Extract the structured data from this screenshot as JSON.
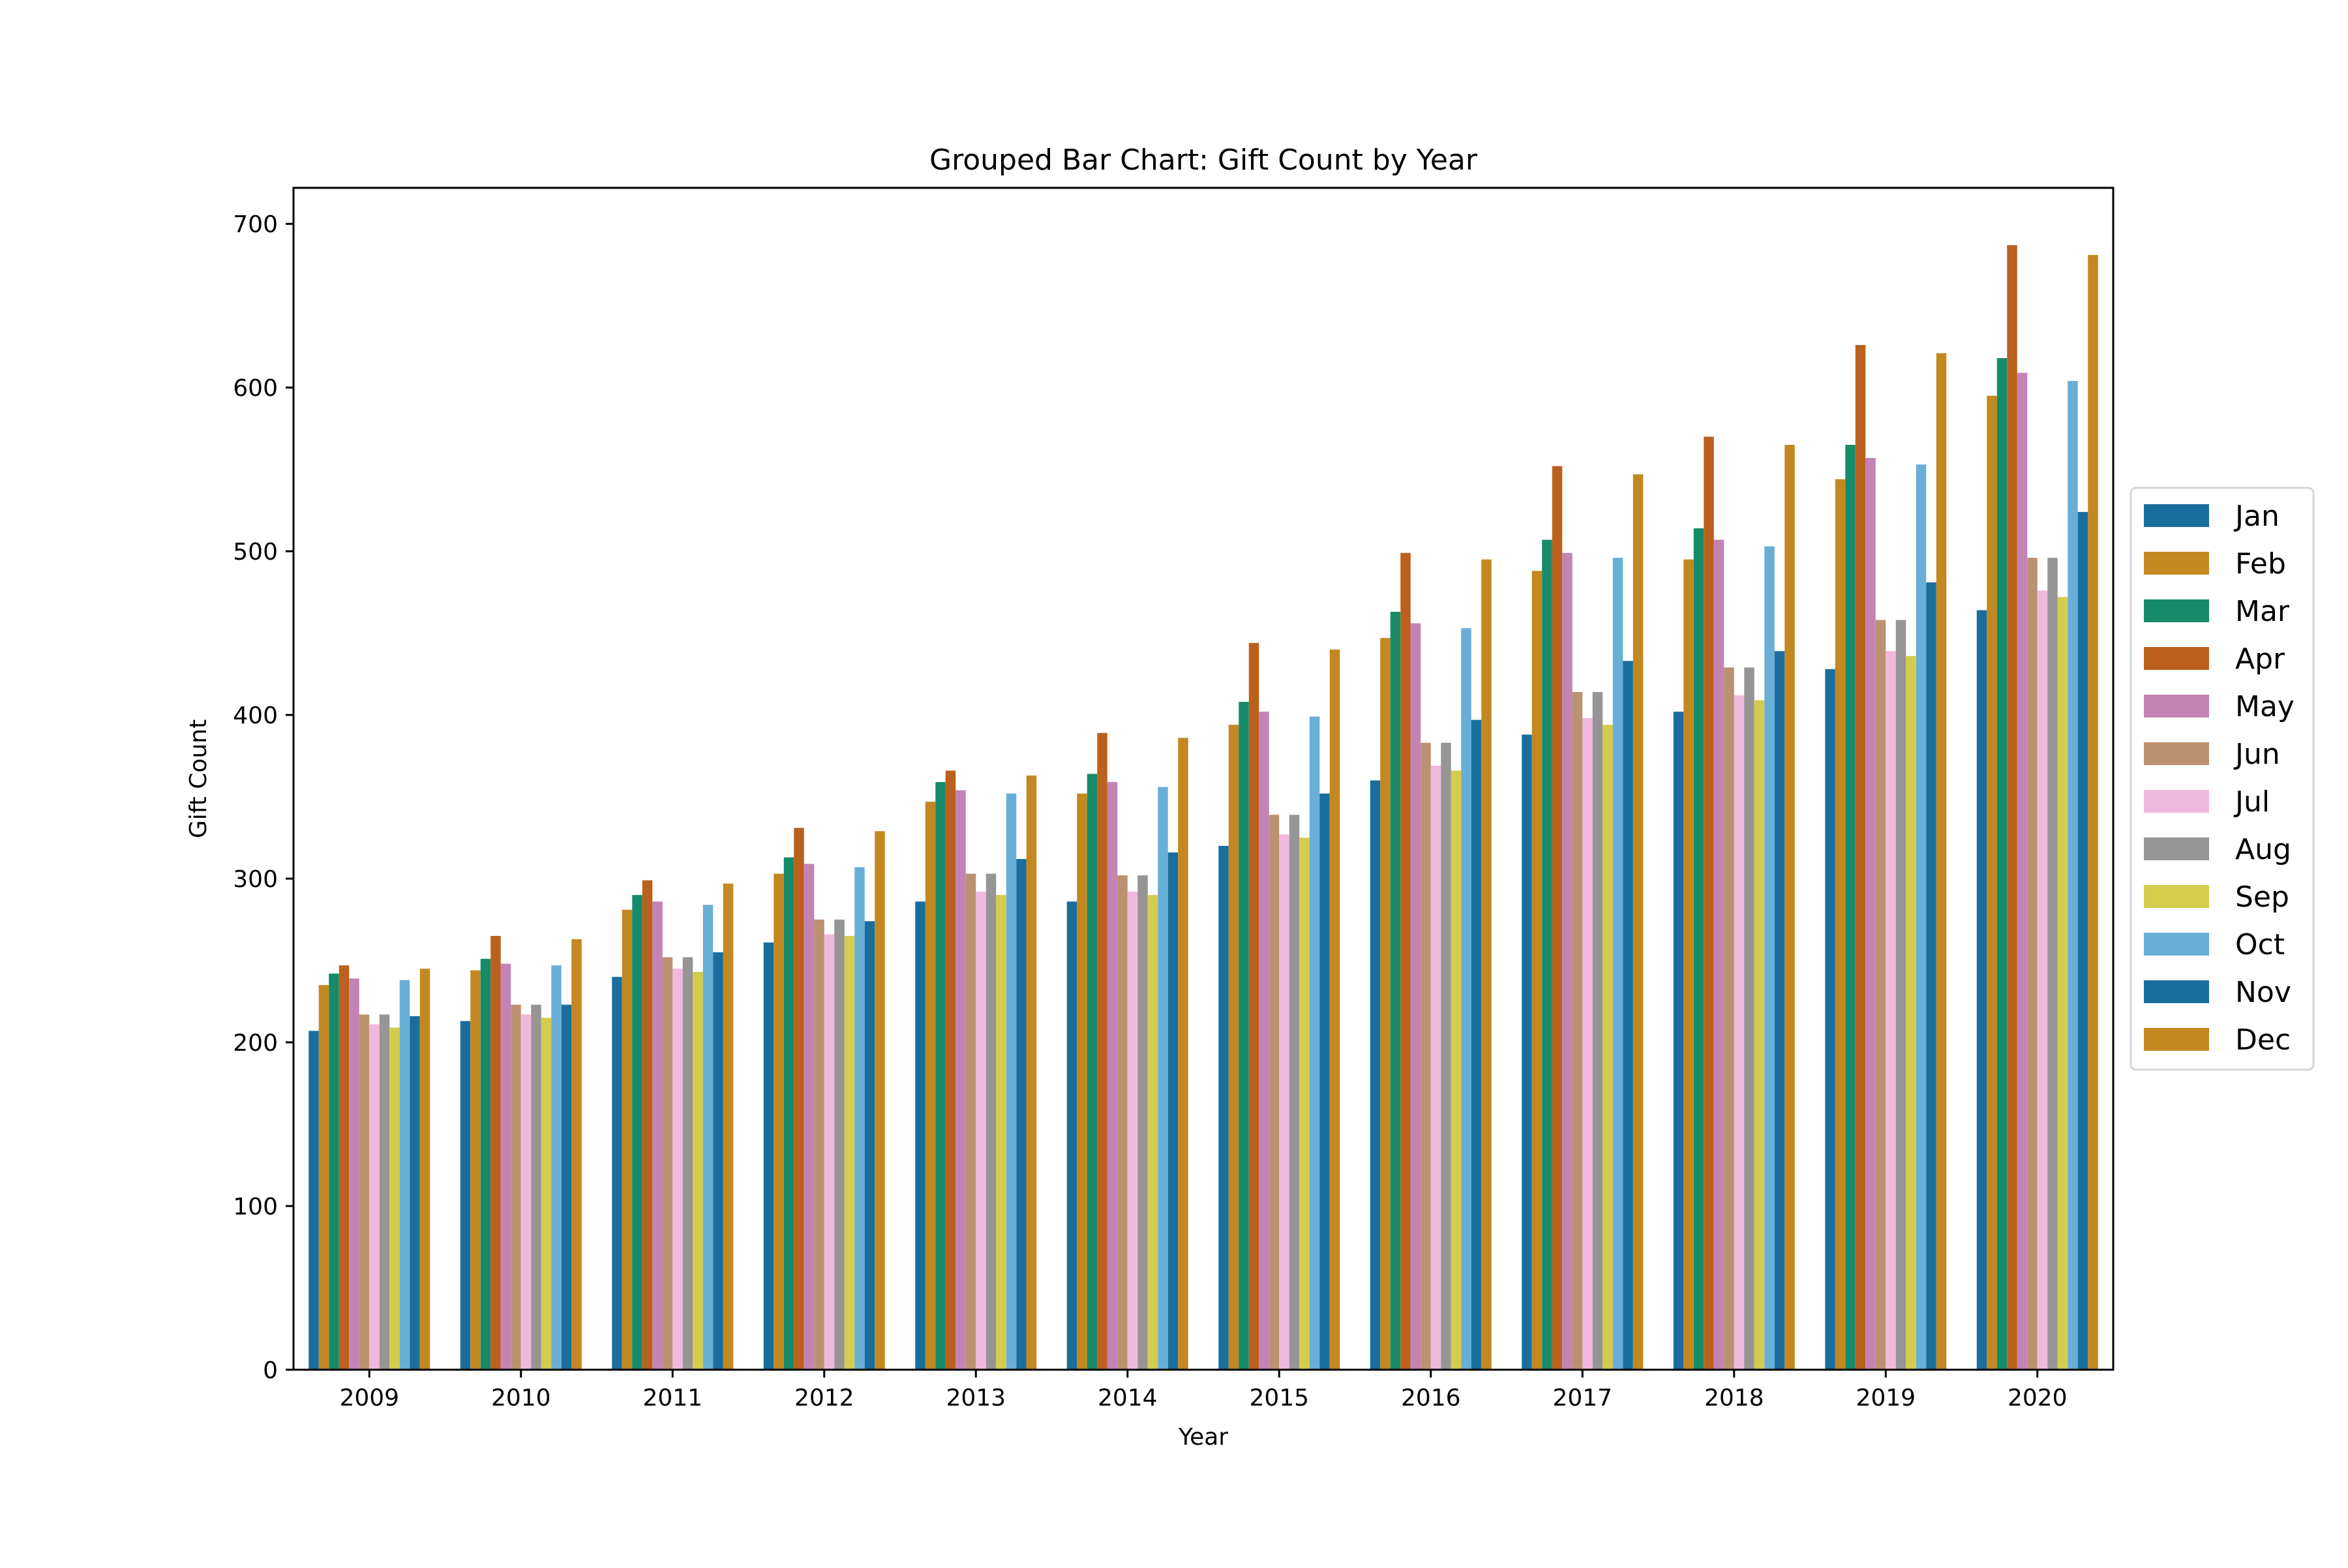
{
  "chart_data": {
    "type": "bar",
    "title": "Grouped Bar Chart: Gift Count by Year",
    "xlabel": "Year",
    "ylabel": "Gift Count",
    "ylim": [
      0,
      722
    ],
    "yticks": [
      0,
      100,
      200,
      300,
      400,
      500,
      600,
      700
    ],
    "grid": false,
    "legend_position": "center-right-outside",
    "categories": [
      "2009",
      "2010",
      "2011",
      "2012",
      "2013",
      "2014",
      "2015",
      "2016",
      "2017",
      "2018",
      "2019",
      "2020"
    ],
    "series": [
      {
        "name": "Jan",
        "color": "#1a6e9e",
        "values": [
          207,
          213,
          240,
          261,
          286,
          286,
          320,
          360,
          388,
          402,
          428,
          464
        ]
      },
      {
        "name": "Feb",
        "color": "#c38820",
        "values": [
          235,
          244,
          281,
          303,
          347,
          352,
          394,
          447,
          488,
          495,
          544,
          595
        ]
      },
      {
        "name": "Mar",
        "color": "#168b69",
        "values": [
          242,
          251,
          290,
          313,
          359,
          364,
          408,
          463,
          507,
          514,
          565,
          618
        ]
      },
      {
        "name": "Apr",
        "color": "#bb611d",
        "values": [
          247,
          265,
          299,
          331,
          366,
          389,
          444,
          499,
          552,
          570,
          626,
          687
        ]
      },
      {
        "name": "May",
        "color": "#c383b4",
        "values": [
          239,
          248,
          286,
          309,
          354,
          359,
          402,
          456,
          499,
          507,
          557,
          609
        ]
      },
      {
        "name": "Jun",
        "color": "#bc9170",
        "values": [
          217,
          223,
          252,
          275,
          303,
          302,
          339,
          383,
          414,
          429,
          458,
          496
        ]
      },
      {
        "name": "Jul",
        "color": "#f1b8dd",
        "values": [
          211,
          217,
          245,
          266,
          292,
          292,
          327,
          369,
          398,
          412,
          439,
          476
        ]
      },
      {
        "name": "Aug",
        "color": "#959595",
        "values": [
          217,
          223,
          252,
          275,
          303,
          302,
          339,
          383,
          414,
          429,
          458,
          496
        ]
      },
      {
        "name": "Sep",
        "color": "#d5cb4c",
        "values": [
          209,
          215,
          243,
          265,
          290,
          290,
          325,
          366,
          394,
          409,
          436,
          472
        ]
      },
      {
        "name": "Oct",
        "color": "#68afd7",
        "values": [
          238,
          247,
          284,
          307,
          352,
          356,
          399,
          453,
          496,
          503,
          553,
          604
        ]
      },
      {
        "name": "Nov",
        "color": "#1a6e9e",
        "values": [
          216,
          223,
          255,
          274,
          312,
          316,
          352,
          397,
          433,
          439,
          481,
          524
        ]
      },
      {
        "name": "Dec",
        "color": "#c38820",
        "values": [
          245,
          263,
          297,
          329,
          363,
          386,
          440,
          495,
          547,
          565,
          621,
          681
        ]
      }
    ]
  }
}
